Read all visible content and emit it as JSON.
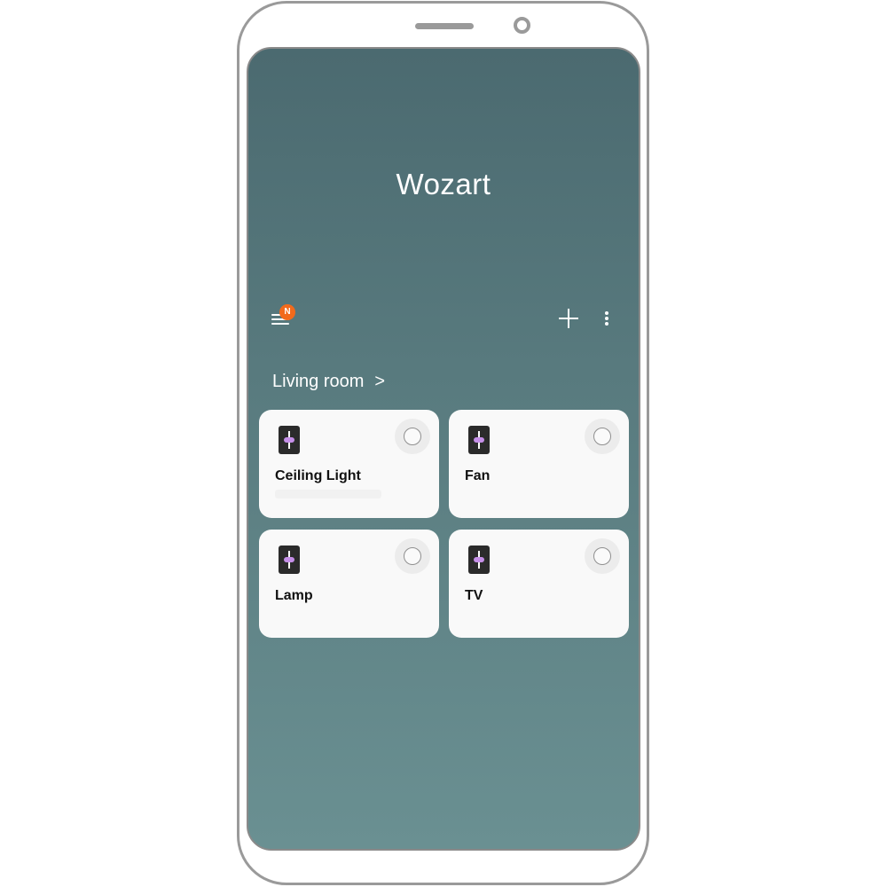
{
  "app": {
    "title": "Wozart"
  },
  "toolbar": {
    "menu_icon": "menu-icon",
    "notification_badge": "N",
    "add_icon": "plus-icon",
    "more_icon": "more-vertical-icon"
  },
  "room": {
    "name": "Living room",
    "chevron": ">"
  },
  "devices": [
    {
      "name": "Ceiling Light",
      "icon": "switch-icon",
      "power": "off"
    },
    {
      "name": "Fan",
      "icon": "switch-icon",
      "power": "off"
    },
    {
      "name": "Lamp",
      "icon": "switch-icon",
      "power": "off"
    },
    {
      "name": "TV",
      "icon": "switch-icon",
      "power": "off"
    }
  ],
  "colors": {
    "accent_badge": "#f26a1b",
    "switch_knob": "#c58fe8",
    "background_top": "#4b6a70",
    "background_bottom": "#6a9092"
  }
}
